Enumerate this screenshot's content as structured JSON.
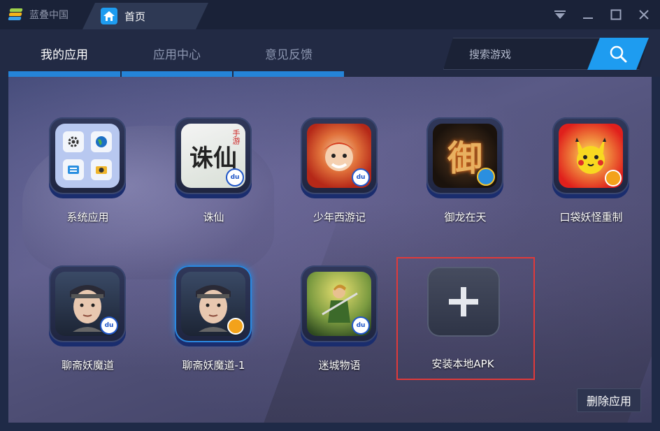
{
  "titlebar": {
    "app_name": "蓝叠中国",
    "home_tab_label": "首页"
  },
  "nav": {
    "tabs": [
      {
        "label": "我的应用",
        "active": true
      },
      {
        "label": "应用中心",
        "active": false
      },
      {
        "label": "意见反馈",
        "active": false
      }
    ]
  },
  "search": {
    "placeholder": "搜索游戏"
  },
  "apps": [
    {
      "label": "系统应用"
    },
    {
      "label": "诛仙",
      "logo_text": "诛仙",
      "logo_small": "手游"
    },
    {
      "label": "少年西游记"
    },
    {
      "label": "御龙在天",
      "logo_text": "御"
    },
    {
      "label": "口袋妖怪重制"
    },
    {
      "label": "聊斋妖魔道"
    },
    {
      "label": "聊斋妖魔道-1"
    },
    {
      "label": "迷城物语"
    }
  ],
  "install": {
    "label": "安装本地APK"
  },
  "delete_button": {
    "label": "删除应用"
  },
  "colors": {
    "accent": "#1e9cf0",
    "tab_underline": "#2584d8",
    "highlight_border": "#e03a3a"
  }
}
